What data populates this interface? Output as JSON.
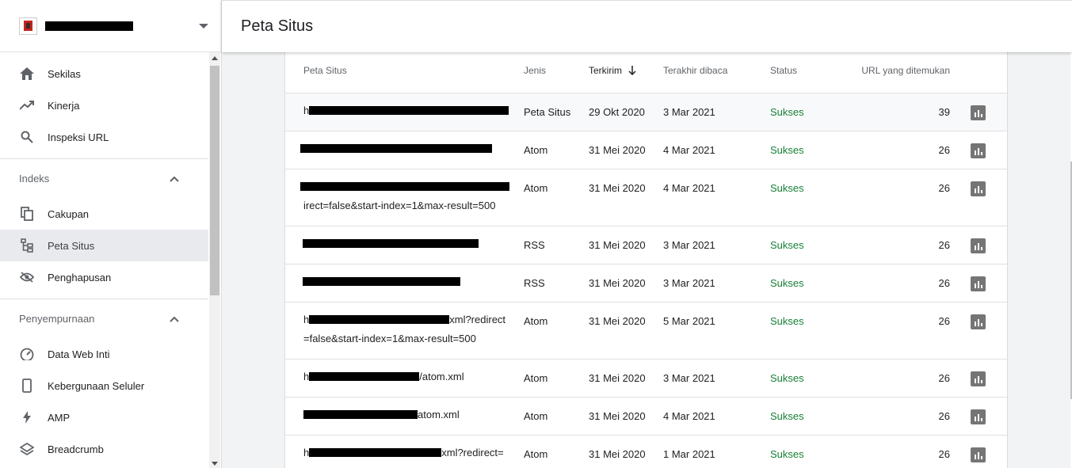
{
  "property": {
    "name_redacted": true
  },
  "sidebar": {
    "items_top": [
      {
        "label": "Sekilas",
        "icon": "home-icon"
      },
      {
        "label": "Kinerja",
        "icon": "trending-up-icon"
      },
      {
        "label": "Inspeksi URL",
        "icon": "search-icon"
      }
    ],
    "sections": [
      {
        "title": "Indeks",
        "items": [
          {
            "label": "Cakupan",
            "icon": "file-copy-icon"
          },
          {
            "label": "Peta Situs",
            "icon": "sitemap-icon",
            "active": true
          },
          {
            "label": "Penghapusan",
            "icon": "eye-off-icon"
          }
        ]
      },
      {
        "title": "Penyempurnaan",
        "items": [
          {
            "label": "Data Web Inti",
            "icon": "speed-icon"
          },
          {
            "label": "Kebergunaan Seluler",
            "icon": "phone-icon"
          },
          {
            "label": "AMP",
            "icon": "lightning-icon"
          },
          {
            "label": "Breadcrumb",
            "icon": "layers-icon"
          }
        ]
      }
    ]
  },
  "header": {
    "title": "Peta Situs"
  },
  "table": {
    "columns": {
      "sitemap": "Peta Situs",
      "type": "Jenis",
      "submitted": "Terkirim",
      "last_read": "Terakhir dibaca",
      "status": "Status",
      "urls": "URL yang ditemukan"
    },
    "sort": {
      "column": "submitted",
      "direction": "desc"
    },
    "rows": [
      {
        "url_pre": "h",
        "url_post": "",
        "url_line2": "",
        "type": "Peta Situs",
        "submitted": "29 Okt 2020",
        "last_read": "3 Mar 2021",
        "status": "Sukses",
        "urls": "39"
      },
      {
        "url_pre": "",
        "url_post": "",
        "url_line2": "",
        "type": "Atom",
        "submitted": "31 Mei 2020",
        "last_read": "4 Mar 2021",
        "status": "Sukses",
        "urls": "26"
      },
      {
        "url_pre": "",
        "url_post": "",
        "url_line2": "irect=false&start-index=1&max-result=500",
        "type": "Atom",
        "submitted": "31 Mei 2020",
        "last_read": "4 Mar 2021",
        "status": "Sukses",
        "urls": "26"
      },
      {
        "url_pre": "",
        "url_post": "",
        "url_line2": "",
        "type": "RSS",
        "submitted": "31 Mei 2020",
        "last_read": "3 Mar 2021",
        "status": "Sukses",
        "urls": "26"
      },
      {
        "url_pre": "",
        "url_post": "",
        "url_line2": "",
        "type": "RSS",
        "submitted": "31 Mei 2020",
        "last_read": "3 Mar 2021",
        "status": "Sukses",
        "urls": "26"
      },
      {
        "url_pre": "h",
        "url_post": "xml?redirect",
        "url_line2": "=false&start-index=1&max-result=500",
        "type": "Atom",
        "submitted": "31 Mei 2020",
        "last_read": "5 Mar 2021",
        "status": "Sukses",
        "urls": "26"
      },
      {
        "url_pre": "h",
        "url_post": "/atom.xml",
        "url_line2": "",
        "type": "Atom",
        "submitted": "31 Mei 2020",
        "last_read": "3 Mar 2021",
        "status": "Sukses",
        "urls": "26"
      },
      {
        "url_pre": "",
        "url_post": "atom.xml",
        "url_line2": "",
        "type": "Atom",
        "submitted": "31 Mei 2020",
        "last_read": "4 Mar 2021",
        "status": "Sukses",
        "urls": "26"
      },
      {
        "url_pre": "h",
        "url_post": "xml?redirect=",
        "url_line2": "",
        "type": "Atom",
        "submitted": "31 Mei 2020",
        "last_read": "1 Mar 2021",
        "status": "Sukses",
        "urls": "26"
      }
    ]
  },
  "colors": {
    "success": "#188038",
    "accent_icon": "#757575"
  }
}
